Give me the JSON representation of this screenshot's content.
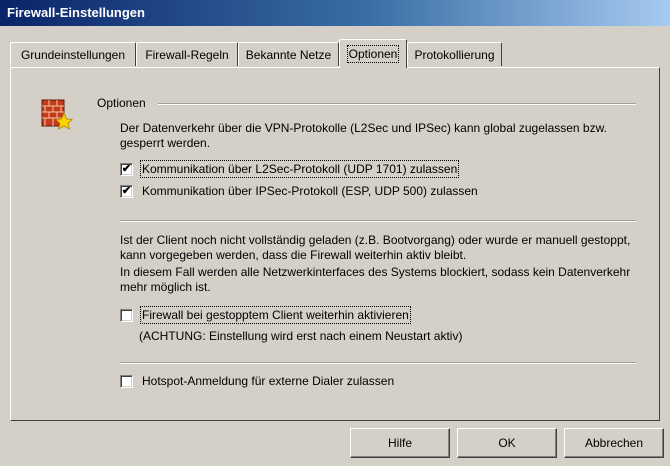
{
  "window": {
    "title": "Firewall-Einstellungen"
  },
  "tabs": [
    {
      "label": "Grundeinstellungen",
      "active": false
    },
    {
      "label": "Firewall-Regeln",
      "active": false
    },
    {
      "label": "Bekannte Netze",
      "active": false
    },
    {
      "label": "Optionen",
      "active": true
    },
    {
      "label": "Protokollierung",
      "active": false
    }
  ],
  "options": {
    "group_title": "Optionen",
    "icon": "firewall-brick-wall-star-icon",
    "vpn_description": "Der Datenverkehr über die VPN-Protokolle (L2Sec und IPSec) kann global zugelassen bzw. gesperrt werden.",
    "checkboxes": [
      {
        "label": "Kommunikation über L2Sec-Protokoll (UDP 1701) zulassen",
        "checked": true
      },
      {
        "label": "Kommunikation über IPSec-Protokoll (ESP, UDP 500) zulassen",
        "checked": true
      }
    ],
    "client_description_1": "Ist der Client noch nicht vollständig geladen (z.B. Bootvorgang) oder wurde er manuell gestoppt, kann vorgegeben werden, dass die Firewall weiterhin aktiv bleibt.",
    "client_description_2": "In diesem Fall werden alle Netzwerkinterfaces des Systems blockiert, sodass kein Datenverkehr mehr möglich ist.",
    "firewall_checkbox": {
      "label": "Firewall bei gestopptem Client weiterhin aktivieren",
      "checked": false
    },
    "warning": "(ACHTUNG: Einstellung wird erst nach einem Neustart aktiv)",
    "hotspot_checkbox": {
      "label": "Hotspot-Anmeldung für externe Dialer zulassen",
      "checked": false
    }
  },
  "buttons": {
    "help": "Hilfe",
    "ok": "OK",
    "cancel": "Abbrechen"
  },
  "check_mark": "✔"
}
